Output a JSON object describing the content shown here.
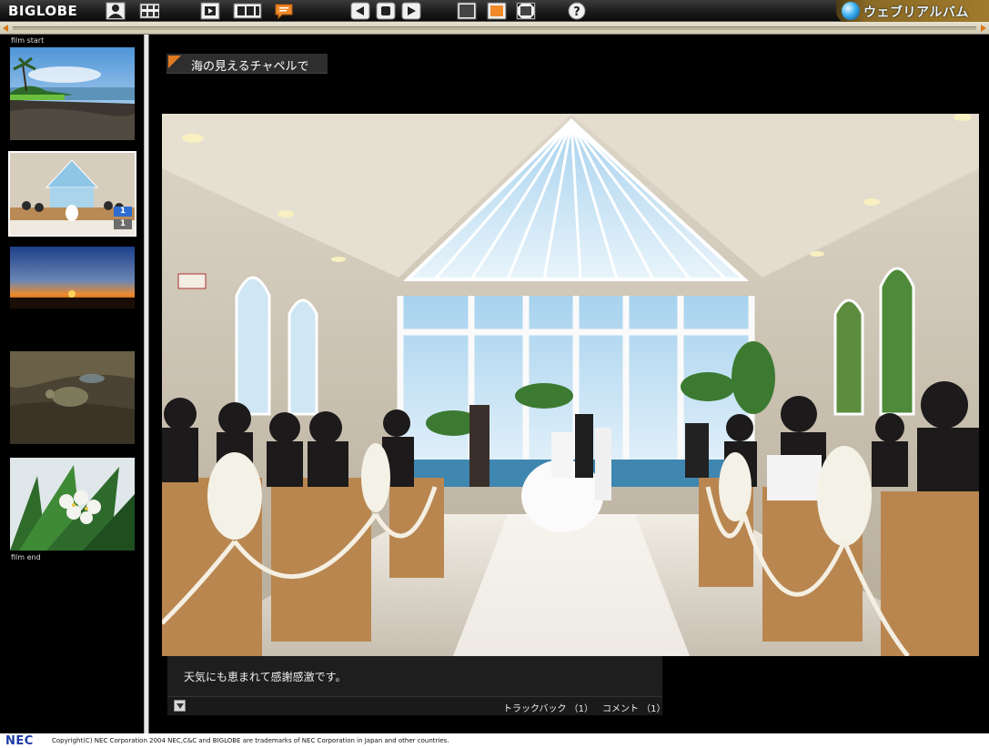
{
  "toolbar": {
    "logo": "BIGLOBE",
    "brand": "ウェブリアルバム",
    "buttons": [
      {
        "name": "profile-button",
        "icon": "user-icon"
      },
      {
        "name": "album-list-button",
        "icon": "album-grid-icon"
      },
      {
        "name": "slideshow-button",
        "icon": "slideshow-icon"
      },
      {
        "name": "film-view-button",
        "icon": "film-icon"
      },
      {
        "name": "comment-button",
        "icon": "comment-icon"
      },
      {
        "name": "previous-button",
        "icon": "previous-icon"
      },
      {
        "name": "stop-button",
        "icon": "stop-icon"
      },
      {
        "name": "next-button",
        "icon": "next-icon"
      },
      {
        "name": "small-size-button",
        "icon": "small-frame-icon"
      },
      {
        "name": "large-size-button",
        "icon": "large-frame-icon"
      },
      {
        "name": "fit-size-button",
        "icon": "fit-frame-icon"
      },
      {
        "name": "help-button",
        "icon": "help-icon"
      }
    ]
  },
  "filmstrip": {
    "start_label": "film start",
    "end_label": "film end",
    "thumbnails": [
      {
        "name": "thumb-coast",
        "selected": false
      },
      {
        "name": "thumb-chapel",
        "selected": true,
        "trackback_count": "1",
        "comment_count": "1"
      },
      {
        "name": "thumb-sunset",
        "selected": false
      },
      {
        "name": "thumb-turtle",
        "selected": false
      },
      {
        "name": "thumb-palm-flower",
        "selected": false
      }
    ]
  },
  "main": {
    "title": "海の見えるチャペルで",
    "caption": "天気にも恵まれて感謝感激です。",
    "trackback": "トラックバック （1）",
    "comment": "コメント （1）"
  },
  "footer": {
    "nec_logo": "NEC",
    "copyright": "Copyright(C) NEC Corporation 2004 NEC,C&C and BIGLOBE are trademarks of NEC Corporation in Japan and other countries."
  },
  "colors": {
    "accent": "#e07a22",
    "toolbar": "#1c1c1c",
    "timeline": "#d6d0ba",
    "badge_trackback": "#2e6ccf"
  }
}
